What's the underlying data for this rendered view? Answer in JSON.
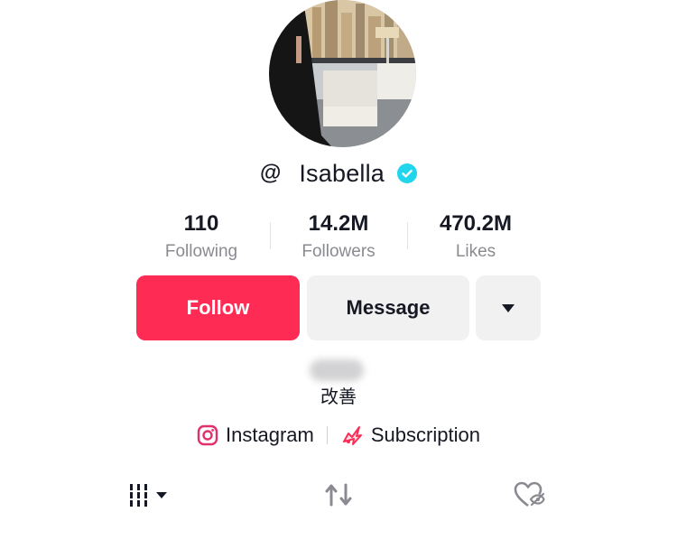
{
  "profile": {
    "at_sign": "@",
    "username": "Isabella",
    "bio_text": "改善"
  },
  "stats": [
    {
      "value": "110",
      "label": "Following"
    },
    {
      "value": "14.2M",
      "label": "Followers"
    },
    {
      "value": "470.2M",
      "label": "Likes"
    }
  ],
  "actions": {
    "follow_label": "Follow",
    "message_label": "Message"
  },
  "links": {
    "instagram_label": "Instagram",
    "subscription_label": "Subscription"
  },
  "icons": {
    "verified": "verified-badge-icon",
    "more": "chevron-down-icon",
    "instagram": "instagram-icon",
    "subscription": "subscription-icon",
    "videos_tab": "grid-icon",
    "reposts_tab": "repost-icon",
    "liked_tab": "liked-private-icon"
  },
  "colors": {
    "accent": "#fe2c55",
    "verified": "#20d5ec",
    "secondary_text": "#8a8b91"
  }
}
